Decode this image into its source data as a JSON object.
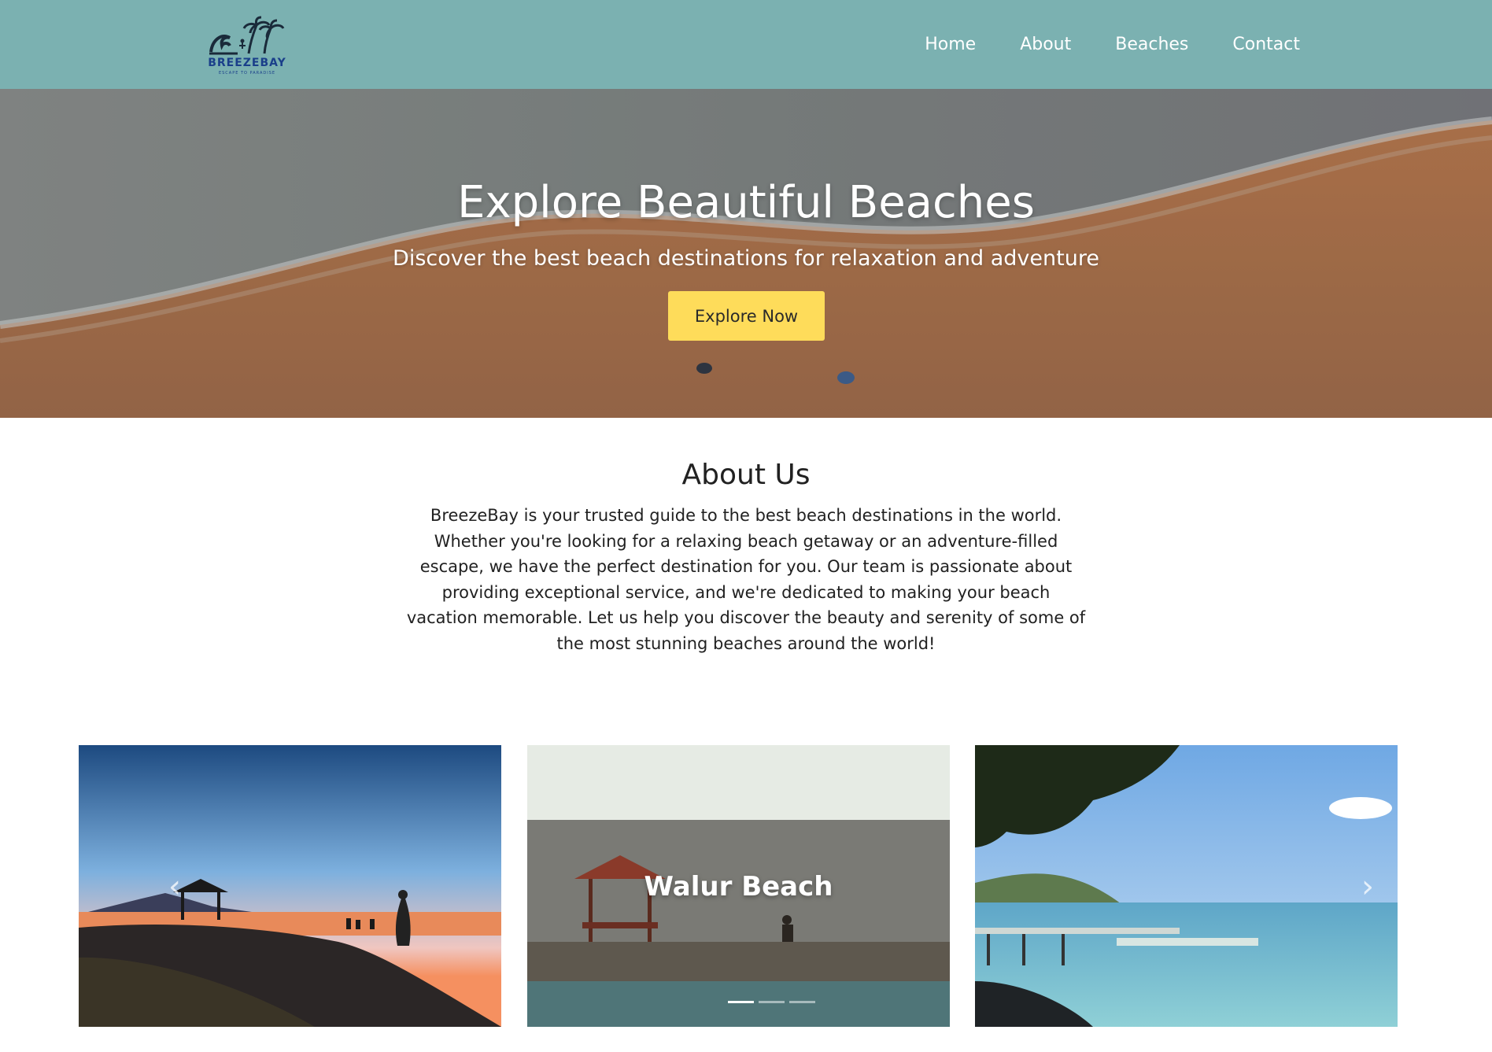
{
  "brand": {
    "name": "BREEZEBAY",
    "tagline": "ESCAPE TO PARADISE"
  },
  "nav": {
    "items": [
      {
        "label": "Home"
      },
      {
        "label": "About"
      },
      {
        "label": "Beaches"
      },
      {
        "label": "Contact"
      }
    ]
  },
  "hero": {
    "title": "Explore Beautiful Beaches",
    "subtitle": "Discover the best beach destinations for relaxation and adventure",
    "button_label": "Explore Now"
  },
  "about": {
    "title": "About Us",
    "lines": [
      "BreezeBay is your trusted guide to the best beach destinations in the world.",
      "Whether you're looking for a relaxing beach getaway or an adventure-filled",
      "escape, we have the perfect destination for you. Our team is passionate about",
      "providing exceptional service, and we're dedicated to making your beach",
      "vacation memorable. Let us help you discover the beauty and serenity of some of",
      "the most stunning beaches around the world!"
    ]
  },
  "carousel": {
    "caption": "Walur Beach",
    "prev_icon": "chevron-left-icon",
    "next_icon": "chevron-right-icon",
    "indicator_count": 3,
    "active_indicator": 0
  },
  "colors": {
    "navbar": "#7bb1b1",
    "button": "#fedc5a",
    "brand_text": "#1a3f8a"
  }
}
